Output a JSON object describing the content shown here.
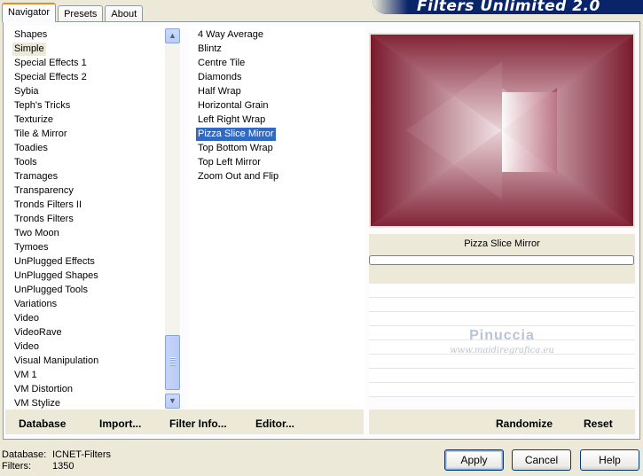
{
  "tabs": [
    {
      "label": "Navigator",
      "active": true
    },
    {
      "label": "Presets",
      "active": false
    },
    {
      "label": "About",
      "active": false
    }
  ],
  "banner_title": "Filters Unlimited 2.0",
  "categories": {
    "selected": "Simple",
    "items": [
      "Shapes",
      "Simple",
      "Special Effects 1",
      "Special Effects 2",
      "Sybia",
      "Teph's Tricks",
      "Texturize",
      "Tile & Mirror",
      "Toadies",
      "Tools",
      "Tramages",
      "Transparency",
      "Tronds Filters II",
      "Tronds Filters",
      "Two Moon",
      "Tymoes",
      "UnPlugged Effects",
      "UnPlugged Shapes",
      "UnPlugged Tools",
      "Variations",
      "Video",
      "VideoRave",
      "Video",
      "Visual Manipulation",
      "VM 1",
      "VM Distortion",
      "VM Stylize"
    ]
  },
  "filters": {
    "selected": "Pizza Slice Mirror",
    "items": [
      "4 Way Average",
      "Blintz",
      "Centre Tile",
      "Diamonds",
      "Half Wrap",
      "Horizontal Grain",
      "Left Right Wrap",
      "Pizza Slice Mirror",
      "Top Bottom Wrap",
      "Top Left Mirror",
      "Zoom Out and Flip"
    ]
  },
  "preview": {
    "caption": "Pizza Slice Mirror",
    "colors": {
      "dark": "#7a1a2e",
      "light": "#f2e2e6"
    },
    "progress": 0
  },
  "watermark": {
    "name": "Pinuccia",
    "site": "www.maidiregrafica.eu"
  },
  "toolbar_left": {
    "database": "Database",
    "import": "Import...",
    "filter_info": "Filter Info...",
    "editor": "Editor..."
  },
  "toolbar_right": {
    "randomize": "Randomize",
    "reset": "Reset"
  },
  "status": {
    "database_label": "Database:",
    "database_value": "ICNET-Filters",
    "filters_label": "Filters:",
    "filters_value": "1350"
  },
  "buttons": {
    "apply": "Apply",
    "cancel": "Cancel",
    "help": "Help"
  }
}
